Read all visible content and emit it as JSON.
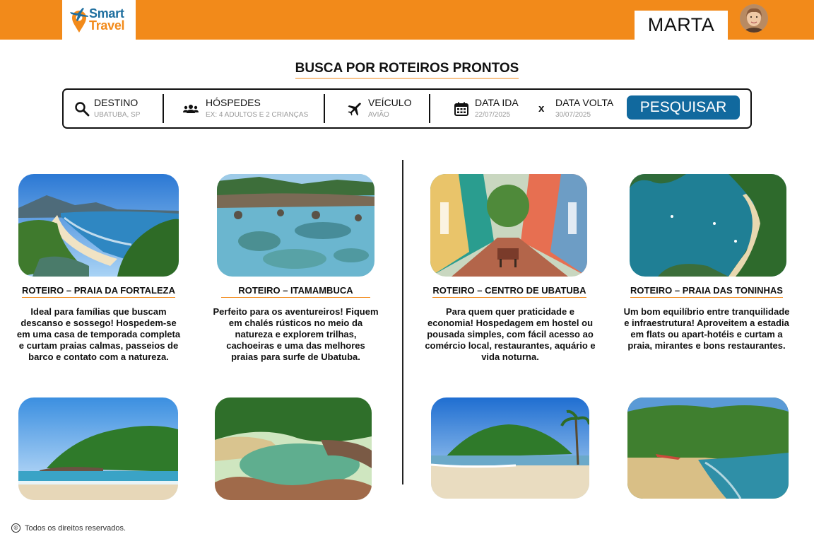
{
  "app": {
    "logo_line1": "Smart",
    "logo_line2": "Travel"
  },
  "user": {
    "name": "MARTA"
  },
  "page_title": "BUSCA POR ROTEIROS PRONTOS",
  "search": {
    "destino": {
      "label": "DESTINO",
      "value": "UBATUBA, SP",
      "icon": "search-icon"
    },
    "hospedes": {
      "label": "HÓSPEDES",
      "value": "EX: 4 ADULTOS E 2 CRIANÇAS",
      "icon": "people-icon"
    },
    "veiculo": {
      "label": "VEÍCULO",
      "value": "AVIÃO",
      "icon": "airplane-icon"
    },
    "data_ida": {
      "label": "DATA IDA",
      "value": "22/07/2025",
      "icon": "calendar-icon"
    },
    "separator": "x",
    "data_volta": {
      "label": "DATA VOLTA",
      "value": "30/07/2025"
    },
    "button": "PESQUISAR"
  },
  "cards": [
    {
      "title": "ROTEIRO – PRAIA DA FORTALEZA",
      "description": "Ideal para famílias que buscam descanso e sossego! Hospedem-se em uma casa de temporada completa e curtam praias calmas, passeios de barco e contato com a natureza."
    },
    {
      "title": "ROTEIRO – ITAMAMBUCA",
      "description": "Perfeito para os aventureiros! Fiquem em chalés rústicos no meio da natureza e explorem trilhas, cachoeiras e uma das melhores praias para surfe de Ubatuba."
    },
    {
      "title": "ROTEIRO – CENTRO DE UBATUBA",
      "description": "Para quem quer praticidade e economia! Hospedagem em hostel ou pousada simples, com fácil acesso ao comércio local, restaurantes, aquário e vida noturna."
    },
    {
      "title": "ROTEIRO – PRAIA DAS TONINHAS",
      "description": "Um bom equilíbrio entre tranquilidade e infraestrutura! Aproveitem a estadia em flats ou apart-hotéis e curtam a praia, mirantes e bons restaurantes."
    }
  ],
  "footer": {
    "copyright": "Todos os direitos reservados."
  },
  "colors": {
    "accent": "#f28a1a",
    "primary": "#11699e"
  }
}
